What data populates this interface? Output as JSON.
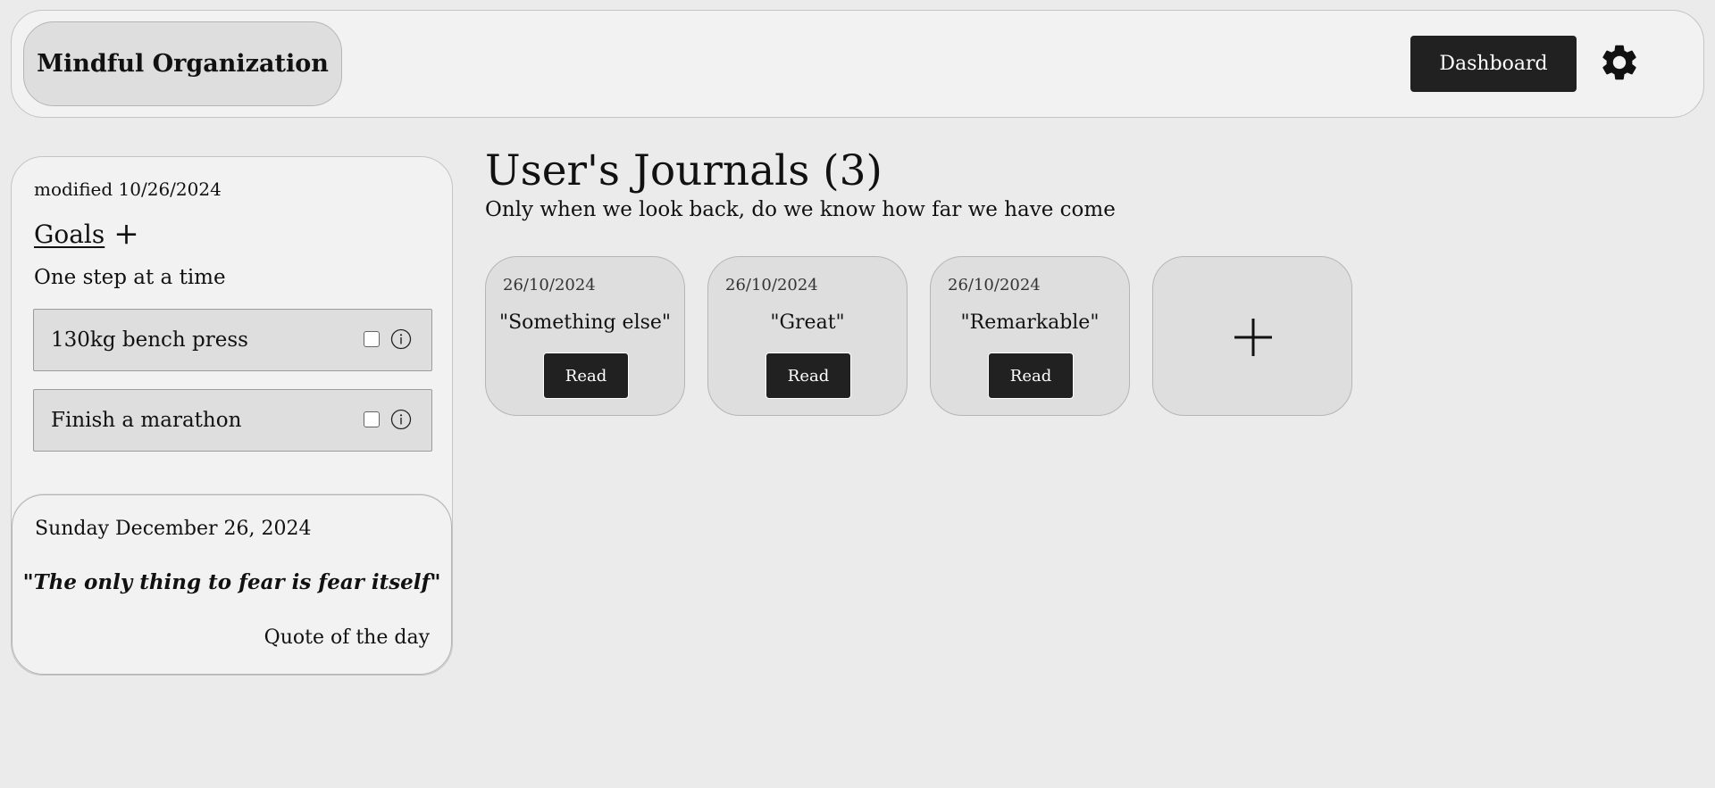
{
  "header": {
    "brand": "Mindful Organization",
    "dashboard_label": "Dashboard",
    "settings_icon": "gear-icon"
  },
  "sidebar": {
    "modified": "modified 10/26/2024",
    "goals_title": "Goals",
    "goals_add": "+",
    "motto": "One step at a time",
    "goals": [
      {
        "label": "130kg bench press",
        "checked": false
      },
      {
        "label": "Finish a marathon",
        "checked": false
      }
    ],
    "quote": {
      "date": "Sunday December 26, 2024",
      "text": "\"The only thing to fear is fear itself\"",
      "label": "Quote of the day"
    }
  },
  "main": {
    "title": "User's Journals (3)",
    "subtitle": "Only when we look back, do we know how far we have come",
    "journals": [
      {
        "date": "26/10/2024",
        "title": "\"Something else\"",
        "button": "Read"
      },
      {
        "date": "26/10/2024",
        "title": "\"Great\"",
        "button": "Read"
      },
      {
        "date": "26/10/2024",
        "title": "\"Remarkable\"",
        "button": "Read"
      }
    ],
    "add_icon": "plus-icon"
  },
  "colors": {
    "background": "#ebebeb",
    "panel": "#f2f2f2",
    "card": "#dedede",
    "button": "#212121"
  }
}
